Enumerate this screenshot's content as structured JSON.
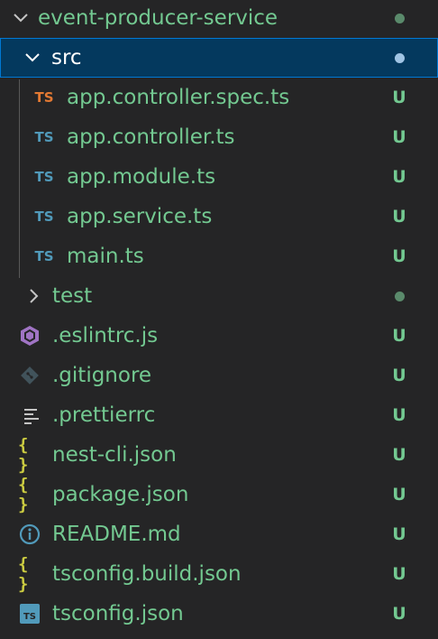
{
  "colors": {
    "untracked": "#73c991",
    "dot_dark": "#5a8a6b",
    "dot_selected": "#a0c4e4",
    "ts_orange": "#e37933",
    "ts_blue": "#519aba",
    "json_yellow": "#cbcb41",
    "eslint_purple": "#a074c4",
    "info_blue": "#519aba",
    "git_gray": "#41535b",
    "selection_bg": "#04395e"
  },
  "explorer": {
    "root": {
      "label": "event-producer-service",
      "icon": "chevron-down-icon"
    },
    "src": {
      "label": "src",
      "icon": "chevron-down-icon"
    },
    "src_files": [
      {
        "label": "app.controller.spec.ts",
        "badge": "TS",
        "status": "U",
        "icon": "typescript-spec-icon"
      },
      {
        "label": "app.controller.ts",
        "badge": "TS",
        "status": "U",
        "icon": "typescript-icon"
      },
      {
        "label": "app.module.ts",
        "badge": "TS",
        "status": "U",
        "icon": "typescript-icon"
      },
      {
        "label": "app.service.ts",
        "badge": "TS",
        "status": "U",
        "icon": "typescript-icon"
      },
      {
        "label": "main.ts",
        "badge": "TS",
        "status": "U",
        "icon": "typescript-icon"
      }
    ],
    "test": {
      "label": "test",
      "icon": "chevron-right-icon"
    },
    "root_files": [
      {
        "label": ".eslintrc.js",
        "status": "U",
        "icon": "eslint-icon"
      },
      {
        "label": ".gitignore",
        "status": "U",
        "icon": "git-icon"
      },
      {
        "label": ".prettierrc",
        "status": "U",
        "icon": "lines-icon"
      },
      {
        "label": "nest-cli.json",
        "status": "U",
        "icon": "json-braces-icon",
        "badge": "{ }"
      },
      {
        "label": "package.json",
        "status": "U",
        "icon": "json-braces-icon",
        "badge": "{ }"
      },
      {
        "label": "README.md",
        "status": "U",
        "icon": "info-icon"
      },
      {
        "label": "tsconfig.build.json",
        "status": "U",
        "icon": "json-braces-icon",
        "badge": "{ }"
      },
      {
        "label": "tsconfig.json",
        "status": "U",
        "icon": "tsconfig-icon",
        "badge": "TS"
      }
    ]
  }
}
